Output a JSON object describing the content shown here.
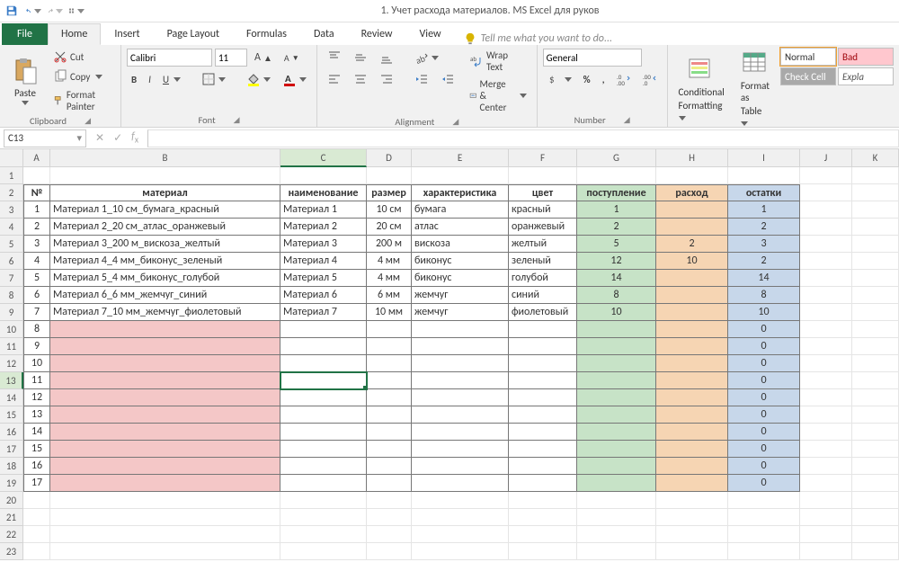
{
  "title": "1. Учет расхода материалов. MS Excel для руков",
  "tabs": {
    "file": "File",
    "home": "Home",
    "insert": "Insert",
    "pagelayout": "Page Layout",
    "formulas": "Formulas",
    "data": "Data",
    "review": "Review",
    "view": "View",
    "tellme": "Tell me what you want to do..."
  },
  "clipboard": {
    "paste": "Paste",
    "cut": "Cut",
    "copy": "Copy",
    "painter": "Format Painter",
    "label": "Clipboard"
  },
  "font": {
    "name": "Calibri",
    "size": "11",
    "label": "Font"
  },
  "alignment": {
    "wrap": "Wrap Text",
    "merge": "Merge & Center",
    "label": "Alignment"
  },
  "number": {
    "format": "General",
    "label": "Number"
  },
  "styles": {
    "cond": "Conditional",
    "cond2": "Formatting",
    "fmttbl": "Format as",
    "fmttbl2": "Table",
    "normal": "Normal",
    "bad": "Bad",
    "check": "Check Cell",
    "expl": "Expla"
  },
  "namebox": "C13",
  "cols": [
    "A",
    "B",
    "C",
    "D",
    "E",
    "F",
    "G",
    "H",
    "I",
    "J",
    "K"
  ],
  "headers": {
    "A": "№",
    "B": "материал",
    "C": "наименование",
    "D": "размер",
    "E": "характеристика",
    "F": "цвет",
    "G": "поступление",
    "H": "расход",
    "I": "остатки"
  },
  "rows": [
    {
      "n": "1",
      "A": "1",
      "B": "Материал 1_10 см_бумага_красный",
      "C": "Материал 1",
      "D": "10 см",
      "E": "бумага",
      "F": "красный",
      "G": "1",
      "H": "",
      "I": "1"
    },
    {
      "n": "2",
      "A": "2",
      "B": "Материал 2_20 см_атлас_оранжевый",
      "C": "Материал 2",
      "D": "20 см",
      "E": "атлас",
      "F": "оранжевый",
      "G": "2",
      "H": "",
      "I": "2"
    },
    {
      "n": "3",
      "A": "3",
      "B": "Материал 3_200 м_вискоза_желтый",
      "C": "Материал 3",
      "D": "200 м",
      "E": "вискоза",
      "F": "желтый",
      "G": "5",
      "H": "2",
      "I": "3"
    },
    {
      "n": "4",
      "A": "4",
      "B": "Материал 4_4 мм_биконус_зеленый",
      "C": "Материал 4",
      "D": "4 мм",
      "E": "биконус",
      "F": "зеленый",
      "G": "12",
      "H": "10",
      "I": "2"
    },
    {
      "n": "5",
      "A": "5",
      "B": "Материал 5_4 мм_биконус_голубой",
      "C": "Материал 5",
      "D": "4 мм",
      "E": "биконус",
      "F": "голубой",
      "G": "14",
      "H": "",
      "I": "14"
    },
    {
      "n": "6",
      "A": "6",
      "B": "Материал 6_6 мм_жемчуг_синий",
      "C": "Материал 6",
      "D": "6 мм",
      "E": "жемчуг",
      "F": "синий",
      "G": "8",
      "H": "",
      "I": "8"
    },
    {
      "n": "7",
      "A": "7",
      "B": "Материал 7_10 мм_жемчуг_фиолетовый",
      "C": "Материал 7",
      "D": "10 мм",
      "E": "жемчуг",
      "F": "фиолетовый",
      "G": "10",
      "H": "",
      "I": "10"
    },
    {
      "n": "8",
      "A": "8",
      "B": "",
      "C": "",
      "D": "",
      "E": "",
      "F": "",
      "G": "",
      "H": "",
      "I": "0"
    },
    {
      "n": "9",
      "A": "9",
      "B": "",
      "C": "",
      "D": "",
      "E": "",
      "F": "",
      "G": "",
      "H": "",
      "I": "0"
    },
    {
      "n": "10",
      "A": "10",
      "B": "",
      "C": "",
      "D": "",
      "E": "",
      "F": "",
      "G": "",
      "H": "",
      "I": "0"
    },
    {
      "n": "11",
      "A": "11",
      "B": "",
      "C": "",
      "D": "",
      "E": "",
      "F": "",
      "G": "",
      "H": "",
      "I": "0"
    },
    {
      "n": "12",
      "A": "12",
      "B": "",
      "C": "",
      "D": "",
      "E": "",
      "F": "",
      "G": "",
      "H": "",
      "I": "0"
    },
    {
      "n": "13",
      "A": "13",
      "B": "",
      "C": "",
      "D": "",
      "E": "",
      "F": "",
      "G": "",
      "H": "",
      "I": "0"
    },
    {
      "n": "14",
      "A": "14",
      "B": "",
      "C": "",
      "D": "",
      "E": "",
      "F": "",
      "G": "",
      "H": "",
      "I": "0"
    },
    {
      "n": "15",
      "A": "15",
      "B": "",
      "C": "",
      "D": "",
      "E": "",
      "F": "",
      "G": "",
      "H": "",
      "I": "0"
    },
    {
      "n": "16",
      "A": "16",
      "B": "",
      "C": "",
      "D": "",
      "E": "",
      "F": "",
      "G": "",
      "H": "",
      "I": "0"
    },
    {
      "n": "17",
      "A": "17",
      "B": "",
      "C": "",
      "D": "",
      "E": "",
      "F": "",
      "G": "",
      "H": "",
      "I": "0"
    }
  ],
  "emptyRowCount": 4,
  "selectedCol": "C",
  "selectedRow": 13
}
